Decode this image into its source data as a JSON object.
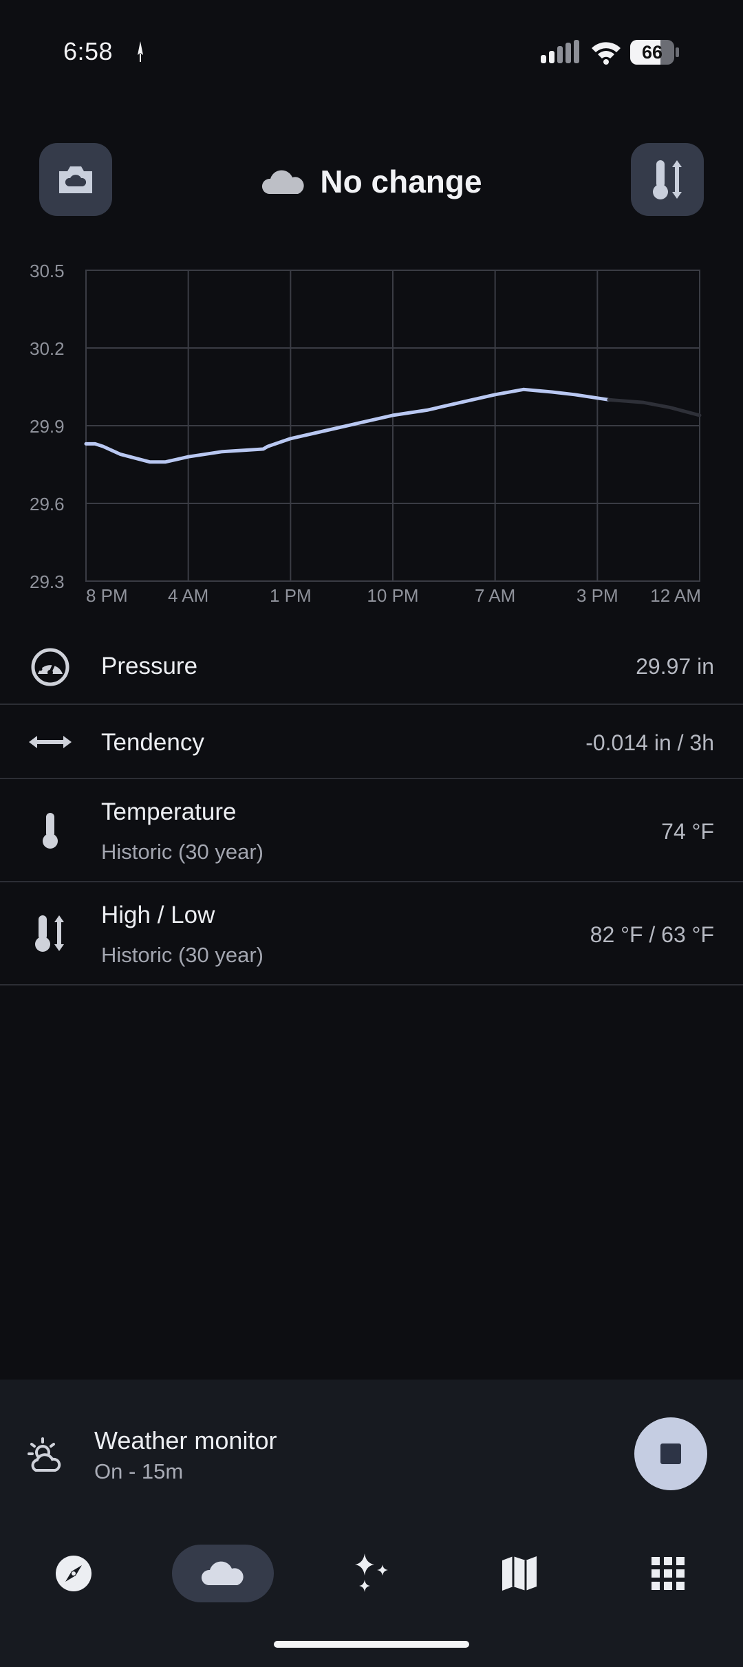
{
  "status_bar": {
    "time": "6:58",
    "battery": "66"
  },
  "header": {
    "title": "No change",
    "left_button_icon": "camera-weather-icon",
    "right_button_icon": "thermometer-high-low-icon",
    "title_icon": "cloud-icon"
  },
  "chart_data": {
    "type": "line",
    "title": "",
    "xlabel": "",
    "ylabel": "",
    "y_ticks": [
      "30.5",
      "30.2",
      "29.9",
      "29.6",
      "29.3"
    ],
    "x_ticks": [
      "8 PM",
      "4 AM",
      "1 PM",
      "10 PM",
      "7 AM",
      "3 PM",
      "12 AM"
    ],
    "ylim": [
      29.3,
      30.5
    ],
    "grid": true,
    "series": [
      {
        "color": "#b9c8f2",
        "points": [
          [
            0,
            29.83
          ],
          [
            0.8,
            29.83
          ],
          [
            1.5,
            29.82
          ],
          [
            3,
            29.79
          ],
          [
            5.6,
            29.76
          ],
          [
            7,
            29.76
          ],
          [
            9,
            29.78
          ],
          [
            12,
            29.8
          ],
          [
            15.6,
            29.81
          ],
          [
            16,
            29.82
          ],
          [
            18,
            29.85
          ],
          [
            21,
            29.88
          ],
          [
            24,
            29.91
          ],
          [
            27,
            29.94
          ],
          [
            30,
            29.96
          ],
          [
            33,
            29.99
          ],
          [
            36,
            30.02
          ],
          [
            38.5,
            30.04
          ],
          [
            41,
            30.03
          ],
          [
            43,
            30.02
          ],
          [
            46,
            30.0
          ]
        ]
      },
      {
        "color": "#2e3038",
        "points": [
          [
            46,
            30.0
          ],
          [
            49,
            29.99
          ],
          [
            51.4,
            29.97
          ],
          [
            54,
            29.94
          ]
        ]
      }
    ]
  },
  "rows": [
    {
      "icon": "gauge-icon",
      "label": "Pressure",
      "sub": "",
      "value": "29.97 in"
    },
    {
      "icon": "horizontal-arrows-icon",
      "label": "Tendency",
      "sub": "",
      "value": "-0.014 in / 3h"
    },
    {
      "icon": "thermometer-icon",
      "label": "Temperature",
      "sub": "Historic (30 year)",
      "value": "74 °F"
    },
    {
      "icon": "thermometer-high-low-icon",
      "label": "High / Low",
      "sub": "Historic (30 year)",
      "value": "82 °F / 63 °F"
    }
  ],
  "monitor": {
    "icon": "weather-monitor-icon",
    "title": "Weather monitor",
    "subtitle": "On - 15m",
    "stop_icon": "stop-icon"
  },
  "nav": [
    {
      "icon": "compass-icon",
      "active": false
    },
    {
      "icon": "cloud-icon",
      "active": true
    },
    {
      "icon": "sparkles-icon",
      "active": false
    },
    {
      "icon": "map-icon",
      "active": false
    },
    {
      "icon": "apps-grid-icon",
      "active": false
    }
  ],
  "colors": {
    "background": "#0d0e12",
    "surface": "#171a20",
    "button": "#353b4a",
    "accent_line": "#b9c8f2",
    "fab": "#c5cde2"
  }
}
